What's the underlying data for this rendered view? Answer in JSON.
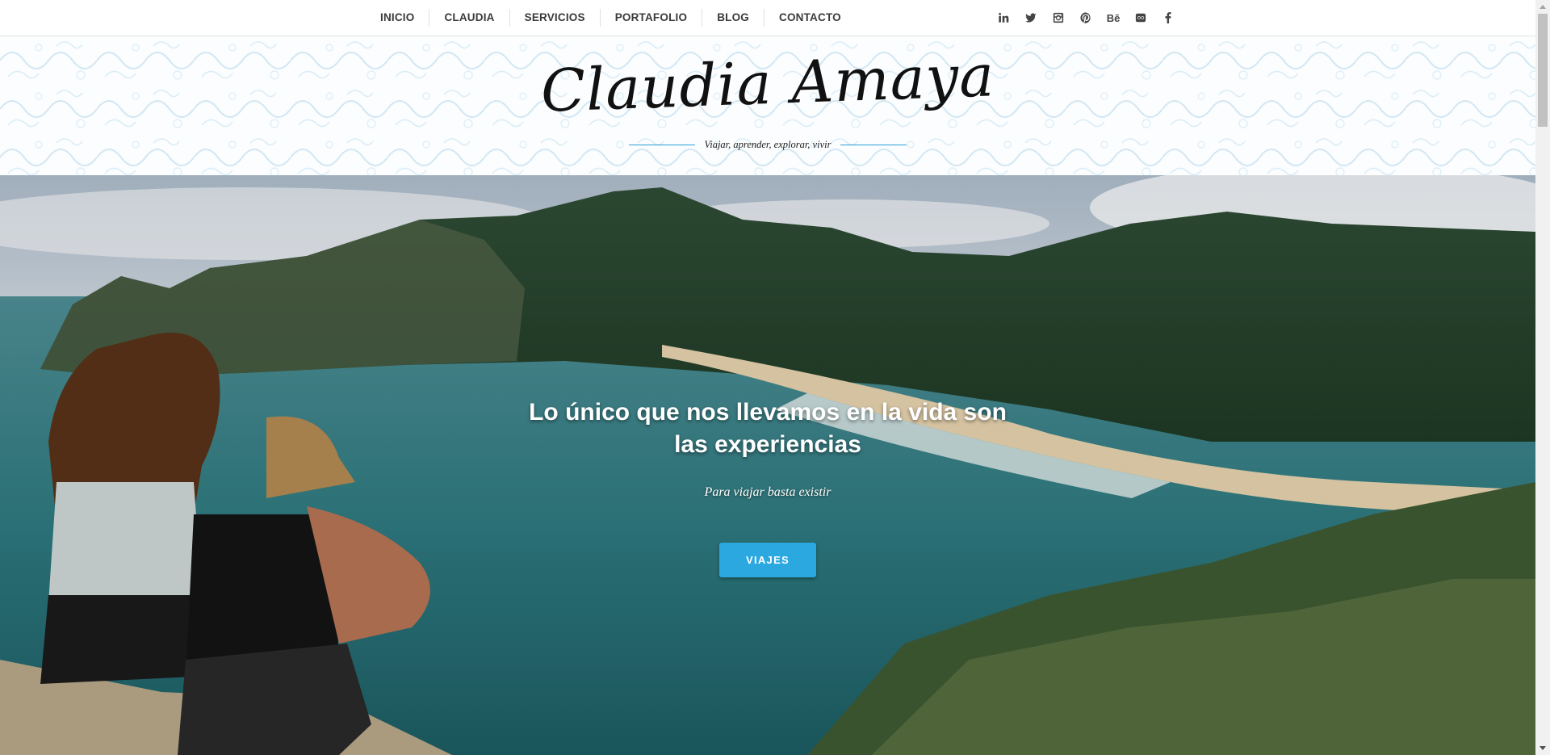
{
  "nav": {
    "items": [
      {
        "label": "INICIO"
      },
      {
        "label": "CLAUDIA"
      },
      {
        "label": "SERVICIOS"
      },
      {
        "label": "PORTAFOLIO"
      },
      {
        "label": "BLOG"
      },
      {
        "label": "CONTACTO"
      }
    ]
  },
  "social": {
    "icons": [
      "linkedin-icon",
      "twitter-icon",
      "instagram-icon",
      "pinterest-icon",
      "behance-icon",
      "flickr-icon",
      "facebook-icon"
    ],
    "behance_text": "Bē"
  },
  "header": {
    "logo_text": "Claudia Amaya",
    "tagline": "Viajar, aprender, explorar, vivir"
  },
  "hero": {
    "headline": "Lo único que nos llevamos en la vida son las experiencias",
    "subtitle": "Para viajar basta existir",
    "button_label": "VIAJES"
  },
  "colors": {
    "accent": "#2ba8e0",
    "nav_text": "#3a3a3a",
    "tagline_line": "#2a9fd8"
  }
}
